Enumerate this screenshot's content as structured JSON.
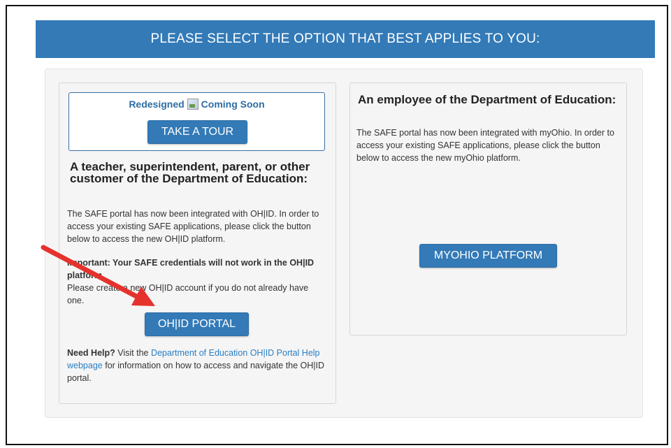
{
  "header": {
    "title": "PLEASE SELECT THE OPTION THAT BEST APPLIES TO YOU:"
  },
  "tour": {
    "prefix": "Redesigned",
    "suffix": "Coming Soon",
    "button_label": "TAKE A TOUR"
  },
  "left": {
    "heading": "A teacher, superintendent, parent, or other customer of the Department of Education:",
    "paragraph": "The SAFE portal has now been integrated with OH|ID. In order to access your existing SAFE applications, please click the button below to access the new OH|ID platform.",
    "important_bold": "Important: Your SAFE credentials will not work in the OH|ID platform.",
    "important_note": "Please create a new OH|ID account if you do not already have one.",
    "button_label": "OH|ID PORTAL",
    "help_bold": "Need Help?",
    "help_pre": " Visit the ",
    "help_link": "Department of Education OH|ID Portal Help webpage",
    "help_post": " for information on how to access and navigate the OH|ID portal."
  },
  "right": {
    "heading": "An employee of the Department of Education:",
    "paragraph": "The SAFE portal has now been integrated with myOhio. In order to access your existing SAFE applications, please click the button below to access the new myOhio platform.",
    "button_label": "MYOHIO PLATFORM"
  },
  "colors": {
    "accent": "#337ab7",
    "link": "#2a7ec3",
    "annotation_arrow": "#e5322d"
  }
}
